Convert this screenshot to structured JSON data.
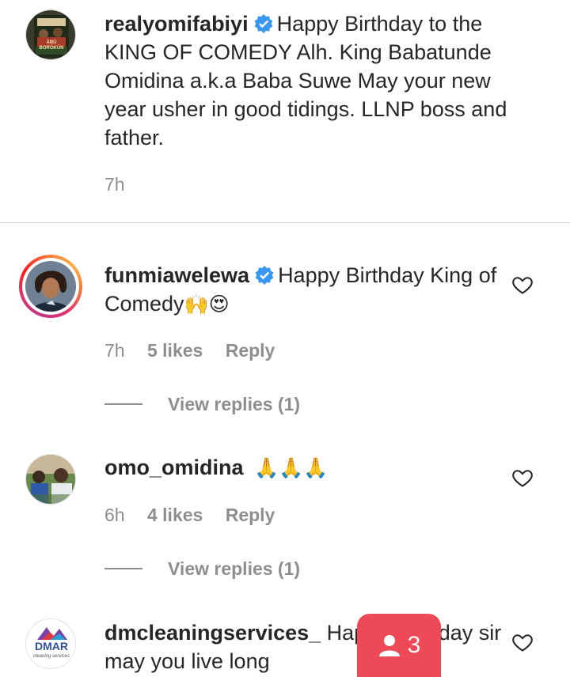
{
  "caption": {
    "username": "realyomifabiyi",
    "text": "Happy Birthday to the KING OF COMEDY Alh. King Babatunde Omidina a.k.a Baba Suwe May your new year usher in good tidings. LLNP boss and father.",
    "time": "7h",
    "avatar_text": "ÀBÙ BORÒKÚN"
  },
  "comments": [
    {
      "username": "funmiawelewa",
      "verified": true,
      "text": "Happy Birthday King of Comedy",
      "emoji": "🙌😍",
      "time": "7h",
      "likes": "5 likes",
      "reply_label": "Reply",
      "view_replies": "View replies (1)"
    },
    {
      "username": "omo_omidina",
      "verified": false,
      "text": "",
      "emoji": "🙏🙏🙏",
      "time": "6h",
      "likes": "4 likes",
      "reply_label": "Reply",
      "view_replies": "View replies (1)"
    },
    {
      "username": "dmcleaningservices_",
      "verified": false,
      "text": "Happy Birthday sir may you live long",
      "avatar_text": "DMAR",
      "avatar_subtext": "cleaning services"
    }
  ],
  "activity_badge": {
    "icon": "person-icon",
    "count": "3",
    "color": "#ed4956"
  },
  "colors": {
    "text": "#262626",
    "secondary": "#8e8e8e",
    "verified": "#3897f0",
    "divider": "#dbdbdb"
  }
}
